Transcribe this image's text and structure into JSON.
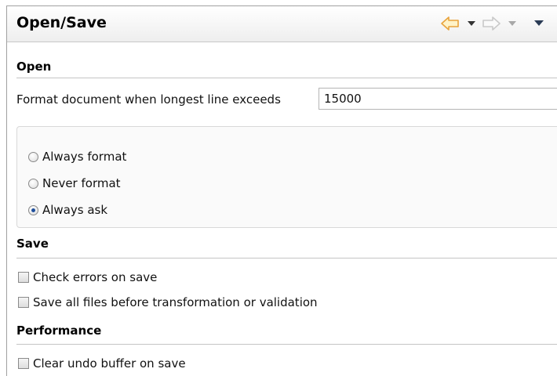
{
  "header": {
    "title": "Open/Save"
  },
  "open": {
    "title": "Open",
    "format_label": "Format document when longest line exceeds",
    "format_value": "15000",
    "radios": [
      {
        "label": "Always format",
        "checked": false
      },
      {
        "label": "Never format",
        "checked": false
      },
      {
        "label": "Always ask",
        "checked": true
      }
    ]
  },
  "save": {
    "title": "Save",
    "checks": [
      {
        "label": "Check errors on save",
        "checked": false
      },
      {
        "label": "Save all files before transformation or validation",
        "checked": false
      }
    ]
  },
  "performance": {
    "title": "Performance",
    "checks": [
      {
        "label": "Clear undo buffer on save",
        "checked": false
      }
    ]
  },
  "colors": {
    "nav_arrow": "#e8a33c",
    "nav_arrow_disabled": "#c9c9c9",
    "radio_dot": "#1f4f9c"
  }
}
